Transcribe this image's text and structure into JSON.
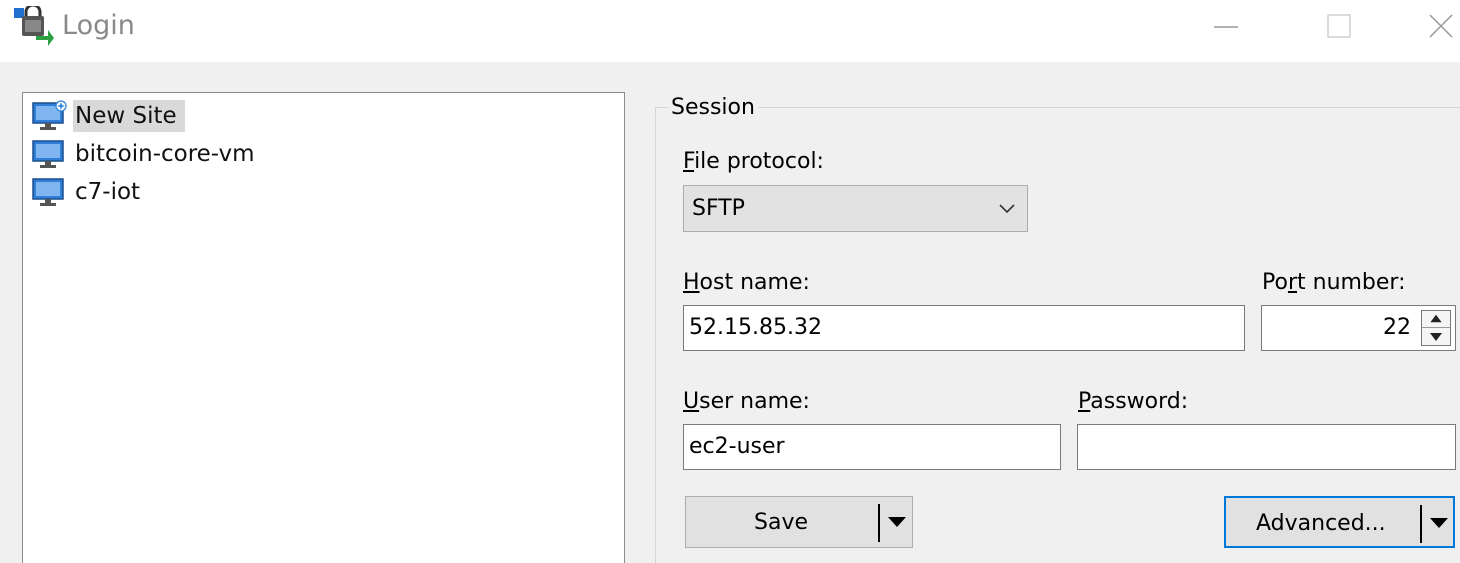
{
  "window": {
    "title": "Login",
    "icon": "lock-computer-icon",
    "controls": [
      "minimize-icon",
      "maximize-icon",
      "close-icon"
    ]
  },
  "sites": {
    "items": [
      {
        "label": "New Site",
        "icon": "new-site-monitor-icon",
        "selected": true
      },
      {
        "label": "bitcoin-core-vm",
        "icon": "monitor-icon",
        "selected": false
      },
      {
        "label": "c7-iot",
        "icon": "monitor-icon",
        "selected": false
      }
    ]
  },
  "session": {
    "group_title": "Session",
    "file_protocol": {
      "label_mnemonic": "F",
      "label_rest": "ile protocol:",
      "value": "SFTP"
    },
    "host_name": {
      "label_mnemonic": "H",
      "label_rest": "ost name:",
      "value": "52.15.85.32"
    },
    "port_number": {
      "label_pre": "Po",
      "label_mnemonic": "r",
      "label_rest": "t number:",
      "value": "22"
    },
    "user_name": {
      "label_mnemonic": "U",
      "label_rest": "ser name:",
      "value": "ec2-user"
    },
    "password": {
      "label_mnemonic": "P",
      "label_rest": "assword:",
      "value": ""
    }
  },
  "buttons": {
    "save_label": "Save",
    "advanced_label": "Advanced..."
  },
  "colors": {
    "focus_border": "#0078d7",
    "monitor_blue": "#2f7fd8",
    "window_bg": "#f0f0f0"
  }
}
